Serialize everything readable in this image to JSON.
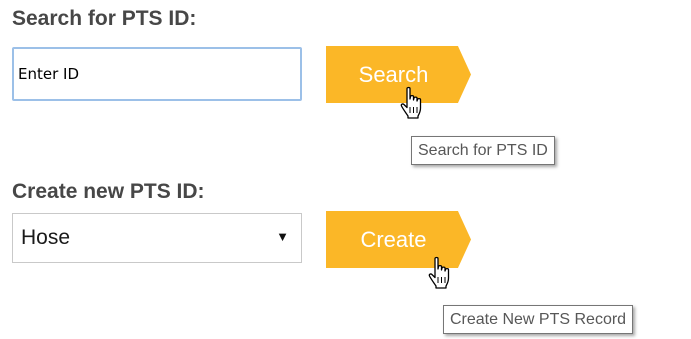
{
  "search": {
    "title": "Search for PTS ID:",
    "input_value": "Enter ID",
    "button_label": "Search",
    "tooltip": "Search for PTS ID"
  },
  "create": {
    "title": "Create new PTS ID:",
    "selected_option": "Hose",
    "button_label": "Create",
    "tooltip": "Create New PTS Record"
  },
  "colors": {
    "button": "#fbb727",
    "title_text": "#474747",
    "input_border": "#9cc0e8"
  },
  "icons": {
    "cursor": "hand-pointer-icon",
    "dropdown": "dropdown-arrow-icon"
  }
}
